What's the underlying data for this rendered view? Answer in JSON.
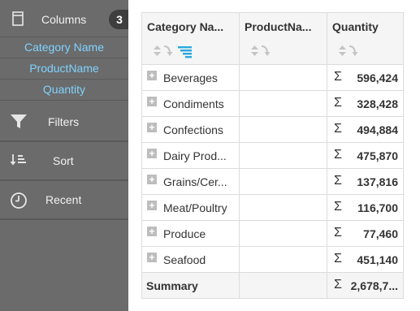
{
  "sidebar": {
    "columns_label": "Columns",
    "columns_count": "3",
    "fields": [
      "Category Name",
      "ProductName",
      "Quantity"
    ],
    "filters_label": "Filters",
    "sort_label": "Sort",
    "recent_label": "Recent",
    "icons": [
      "columns-icon",
      "filter-icon",
      "sort-icon",
      "clock-icon"
    ]
  },
  "grid": {
    "headers": [
      "Category Na...",
      "ProductNa...",
      "Quantity"
    ],
    "rows": [
      {
        "category": "Beverages",
        "product": "",
        "quantity": "596,424"
      },
      {
        "category": "Condiments",
        "product": "",
        "quantity": "328,428"
      },
      {
        "category": "Confections",
        "product": "",
        "quantity": "494,884"
      },
      {
        "category": "Dairy Prod...",
        "product": "",
        "quantity": "475,870"
      },
      {
        "category": "Grains/Cer...",
        "product": "",
        "quantity": "137,816"
      },
      {
        "category": "Meat/Poultry",
        "product": "",
        "quantity": "116,700"
      },
      {
        "category": "Produce",
        "product": "",
        "quantity": "77,460"
      },
      {
        "category": "Seafood",
        "product": "",
        "quantity": "451,140"
      }
    ],
    "summary": {
      "label": "Summary",
      "quantity": "2,678,7..."
    },
    "expand_glyph": "+",
    "sigma_glyph": "Σ"
  },
  "colors": {
    "sidebar_bg": "#6b6b6b",
    "field_text": "#7fd3ff",
    "sort_active": "#2aa8e0",
    "header_bg": "#f5f5f5"
  }
}
